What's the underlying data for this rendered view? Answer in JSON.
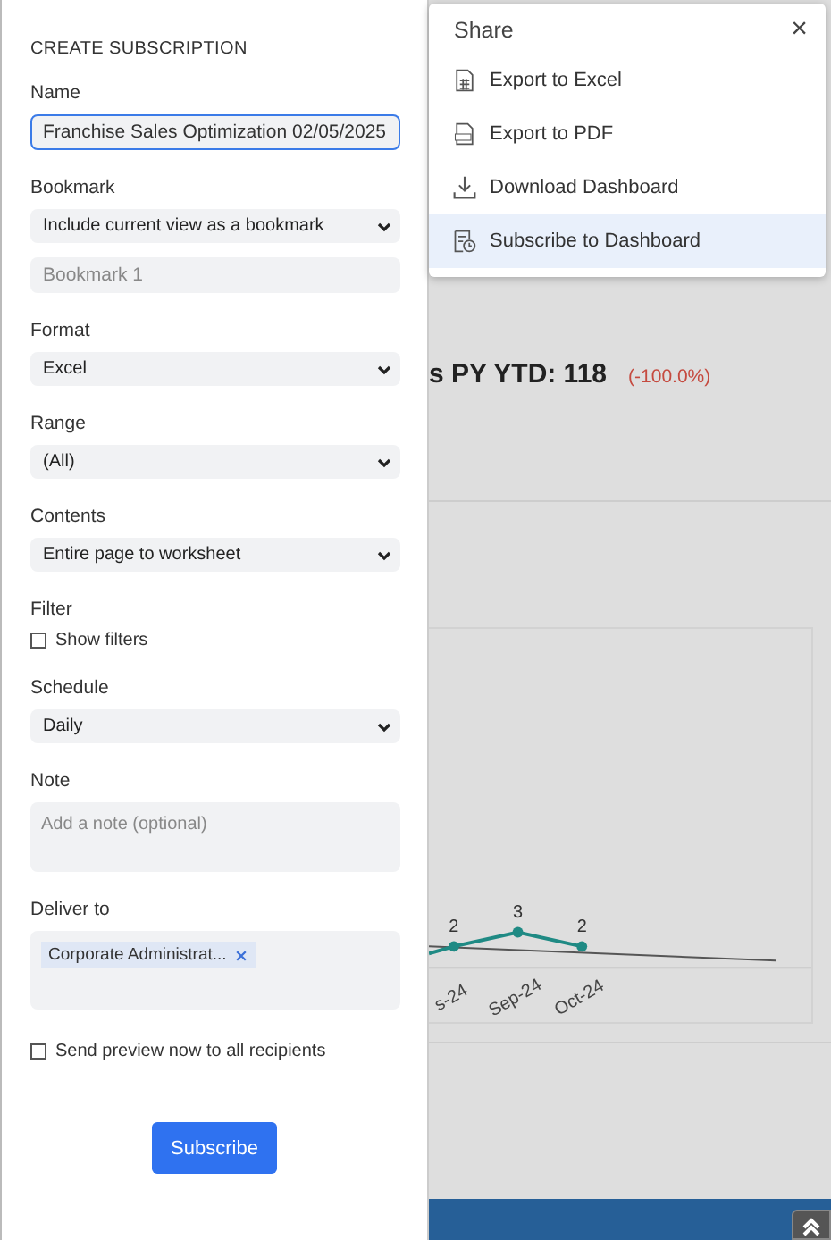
{
  "panel": {
    "title": "CREATE SUBSCRIPTION",
    "name": {
      "label": "Name",
      "value": "Franchise Sales Optimization 02/05/2025",
      "focused": true
    },
    "bookmark": {
      "label": "Bookmark",
      "value": "Include current view as a bookmark",
      "placeholder": "Bookmark 1"
    },
    "format": {
      "label": "Format",
      "value": "Excel"
    },
    "range": {
      "label": "Range",
      "value": "(All)"
    },
    "contents": {
      "label": "Contents",
      "value": "Entire page to worksheet"
    },
    "filter": {
      "label": "Filter",
      "option": "Show filters",
      "checked": false
    },
    "schedule": {
      "label": "Schedule",
      "value": "Daily"
    },
    "note": {
      "label": "Note",
      "placeholder": "Add a note (optional)"
    },
    "deliver_to": {
      "label": "Deliver to",
      "recipients": [
        "Corporate Administrat..."
      ]
    },
    "send_preview": {
      "label": "Send preview now to all recipients",
      "checked": false
    },
    "submit": "Subscribe"
  },
  "share_menu": {
    "title": "Share",
    "close": "×",
    "items": [
      {
        "label": "Export to Excel",
        "kind": "excel",
        "selected": false
      },
      {
        "label": "Export to PDF",
        "kind": "pdf",
        "selected": false
      },
      {
        "label": "Download Dashboard",
        "kind": "download",
        "selected": false
      },
      {
        "label": "Subscribe to Dashboard",
        "kind": "subscribe",
        "selected": true
      }
    ]
  },
  "dashboard": {
    "kpi_compare": "s PY YTD: 118",
    "kpi_change": "(-100.0%)",
    "chart": {
      "point_labels": [
        "2",
        "3",
        "2"
      ],
      "x_labels": [
        "s-24",
        "Sep-24",
        "Oct-24"
      ]
    }
  }
}
